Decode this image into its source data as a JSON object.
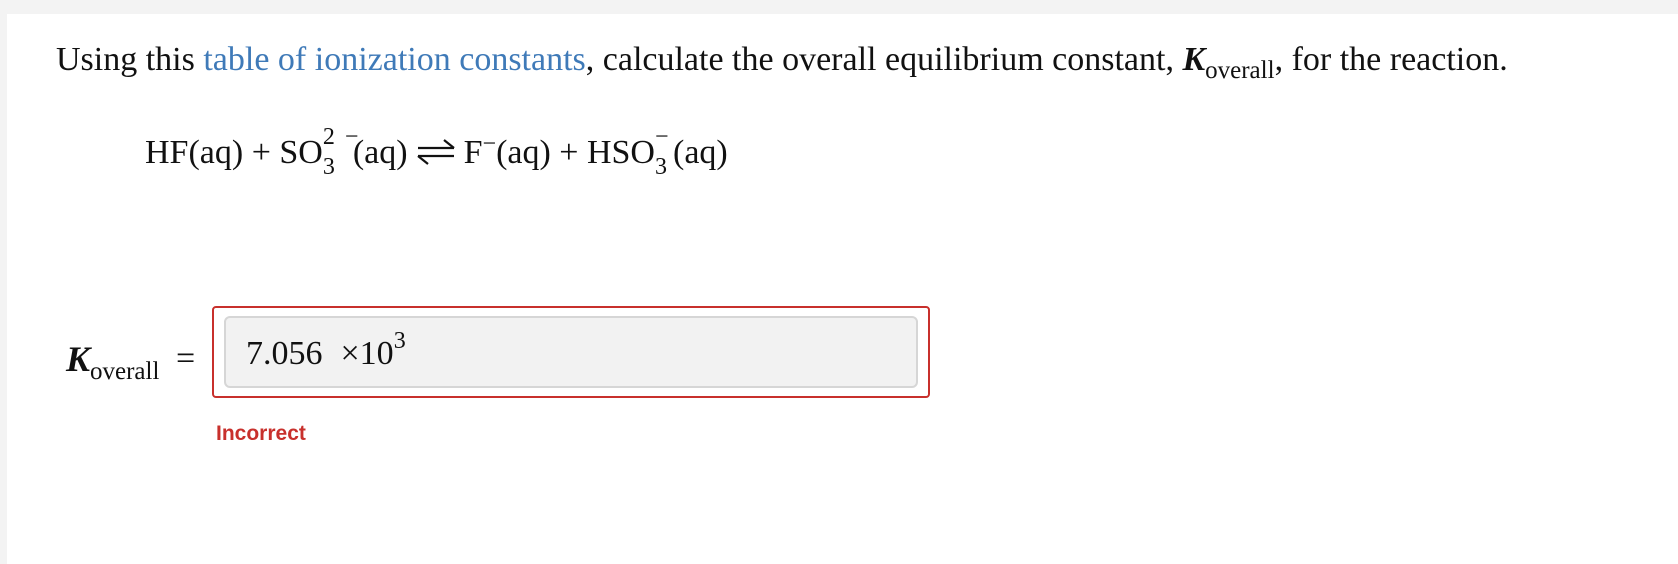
{
  "question": {
    "prefix": "Using this ",
    "link_text": "table of ionization constants",
    "suffix": ", calculate the overall equilibrium constant, ",
    "k_symbol": "K",
    "k_subscript": "overall",
    "end": ", for the reaction."
  },
  "equation": {
    "hf": "HF(aq) + SO",
    "so3_charge": "2 −",
    "so3_sub": "3",
    "aq1": "(aq)",
    "f_part": "F",
    "f_charge": "−",
    "f_aq": "(aq) + HSO",
    "hso3_charge": "−",
    "hso3_sub": "3",
    "aq2": "(aq)"
  },
  "answer": {
    "k_symbol": "K",
    "k_subscript": "overall",
    "equals": "=",
    "mantissa": "7.056",
    "times_base": "×10",
    "exponent": "3",
    "status": "Incorrect"
  },
  "colors": {
    "link": "#3f7ab8",
    "error": "#c8302c",
    "input_bg": "#f2f2f2"
  }
}
